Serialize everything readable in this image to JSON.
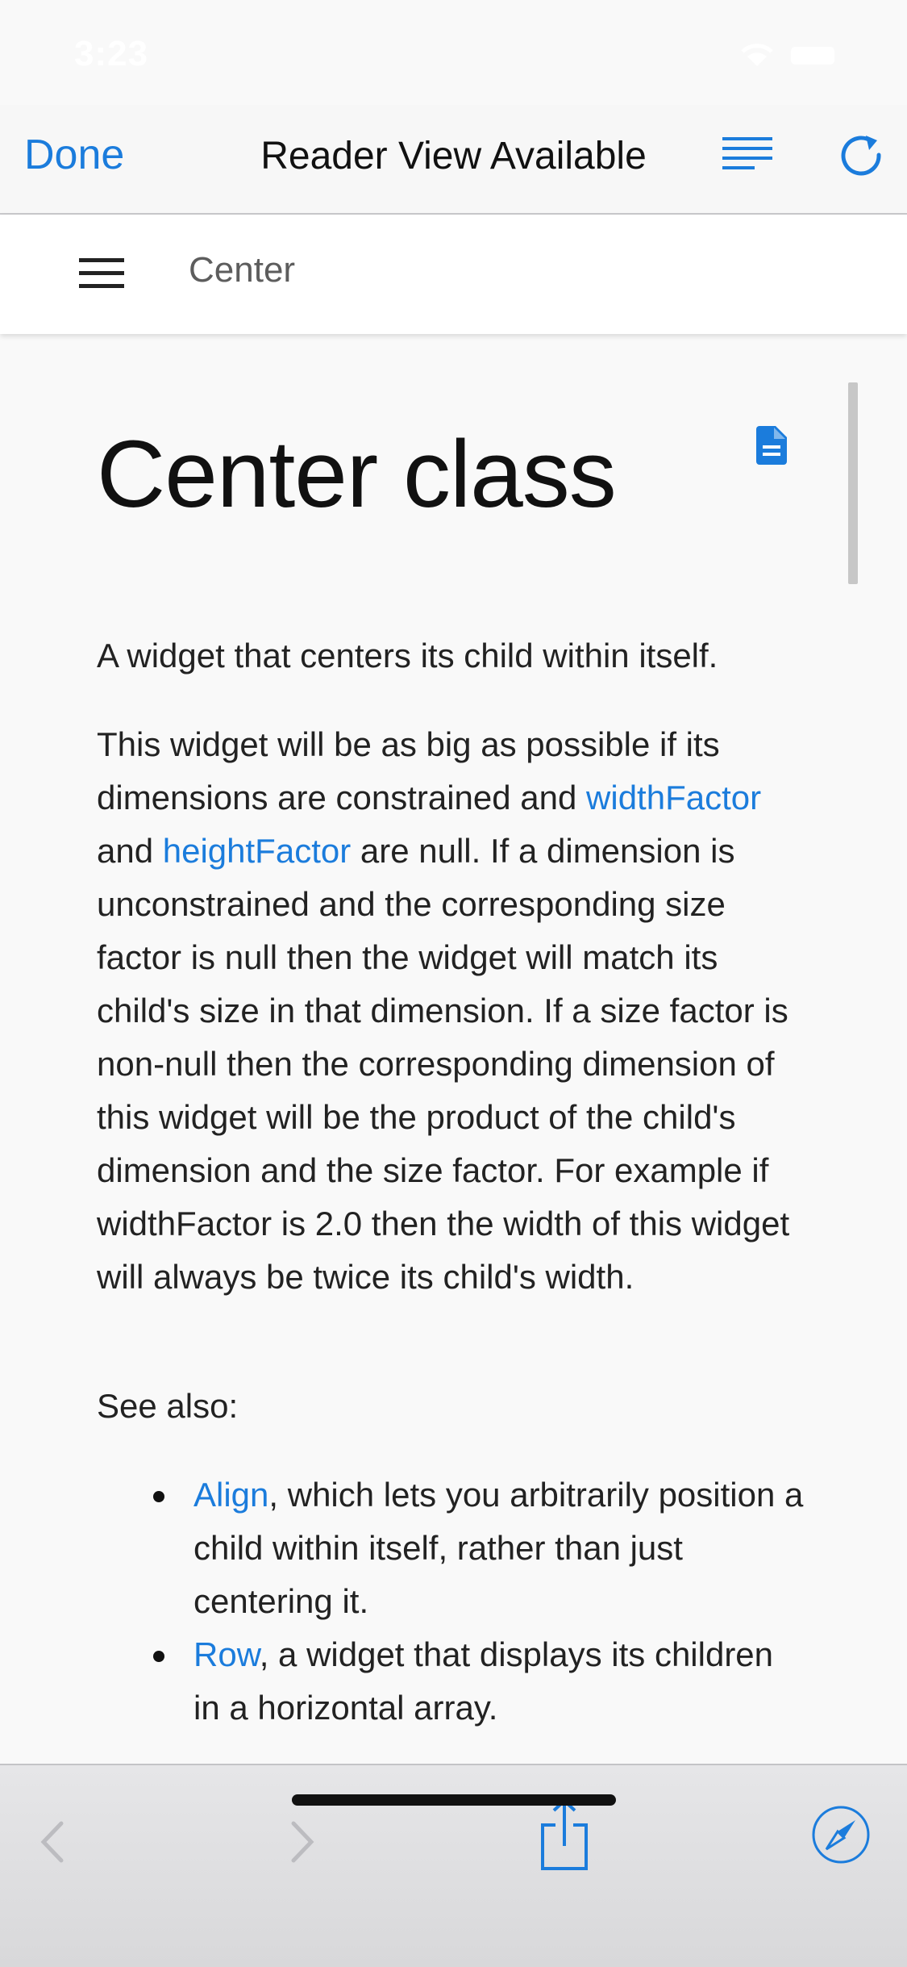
{
  "status_bar": {
    "time": "3:23"
  },
  "nav": {
    "done_label": "Done",
    "title": "Reader View Available",
    "reader_icon": "reader-lines-icon",
    "reload_icon": "reload-icon"
  },
  "doc_header": {
    "title": "Center",
    "menu_icon": "hamburger-menu-icon"
  },
  "article": {
    "title": "Center class",
    "intro": "A widget that centers its child within itself.",
    "para_start": "This widget will be as big as possible if its dimensions are constrained and ",
    "link_width": "widthFactor",
    "and_text": " and ",
    "link_height": "heightFactor",
    "para_rest": " are null. If a dimension is unconstrained and the corresponding size factor is null then the widget will match its child's size in that dimension. If a size factor is non-null then the corresponding dimension of this widget will be the product of the child's dimension and the size factor. For example if widthFactor is 2.0 then the width of this widget will always be twice its child's width.",
    "see_also": "See also:",
    "list": [
      {
        "link": "Align",
        "text": ", which lets you arbitrarily position a child within itself, rather than just centering it."
      },
      {
        "link": "Row",
        "text": ", a widget that displays its children in a horizontal array."
      }
    ]
  },
  "colors": {
    "accent": "#1b7cdc",
    "background": "#f9f9f9"
  }
}
